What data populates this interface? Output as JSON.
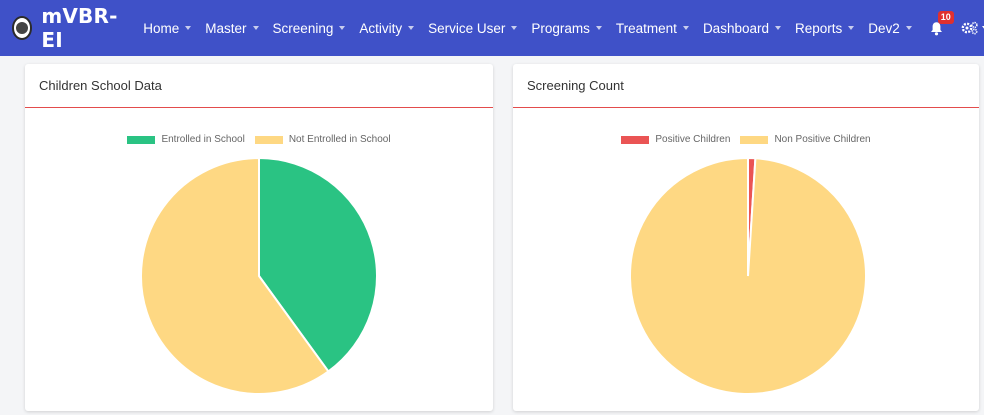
{
  "app": {
    "brand": "mVBR-EI"
  },
  "nav": {
    "items": [
      "Home",
      "Master",
      "Screening",
      "Activity",
      "Service User",
      "Programs",
      "Treatment",
      "Dashboard",
      "Reports",
      "Dev2"
    ],
    "notification_count": "10"
  },
  "icons": [
    "app-logo-icon",
    "bell-icon",
    "gear-icon",
    "user-icon",
    "chevron-down-icon"
  ],
  "colors": {
    "navbar": "#3f51c8",
    "accent_red": "#e34c4c",
    "green": "#2ac383",
    "yellow": "#fed883",
    "red": "#ea5454"
  },
  "cards": {
    "left": {
      "title": "Children School Data",
      "legend": [
        "Entrolled in School",
        "Not Entrolled in School"
      ],
      "chart_data": {
        "type": "pie",
        "labels": [
          "Entrolled in School",
          "Not Entrolled in School"
        ],
        "values": [
          40,
          60
        ],
        "colors": [
          "#2ac383",
          "#fed883"
        ],
        "legend_position": "top"
      }
    },
    "right": {
      "title": "Screening Count",
      "legend": [
        "Positive Children",
        "Non Positive Children"
      ],
      "chart_data": {
        "type": "pie",
        "labels": [
          "Positive Children",
          "Non Positive Children"
        ],
        "values": [
          1,
          99
        ],
        "colors": [
          "#ea5454",
          "#fed883"
        ],
        "legend_position": "top"
      }
    }
  }
}
